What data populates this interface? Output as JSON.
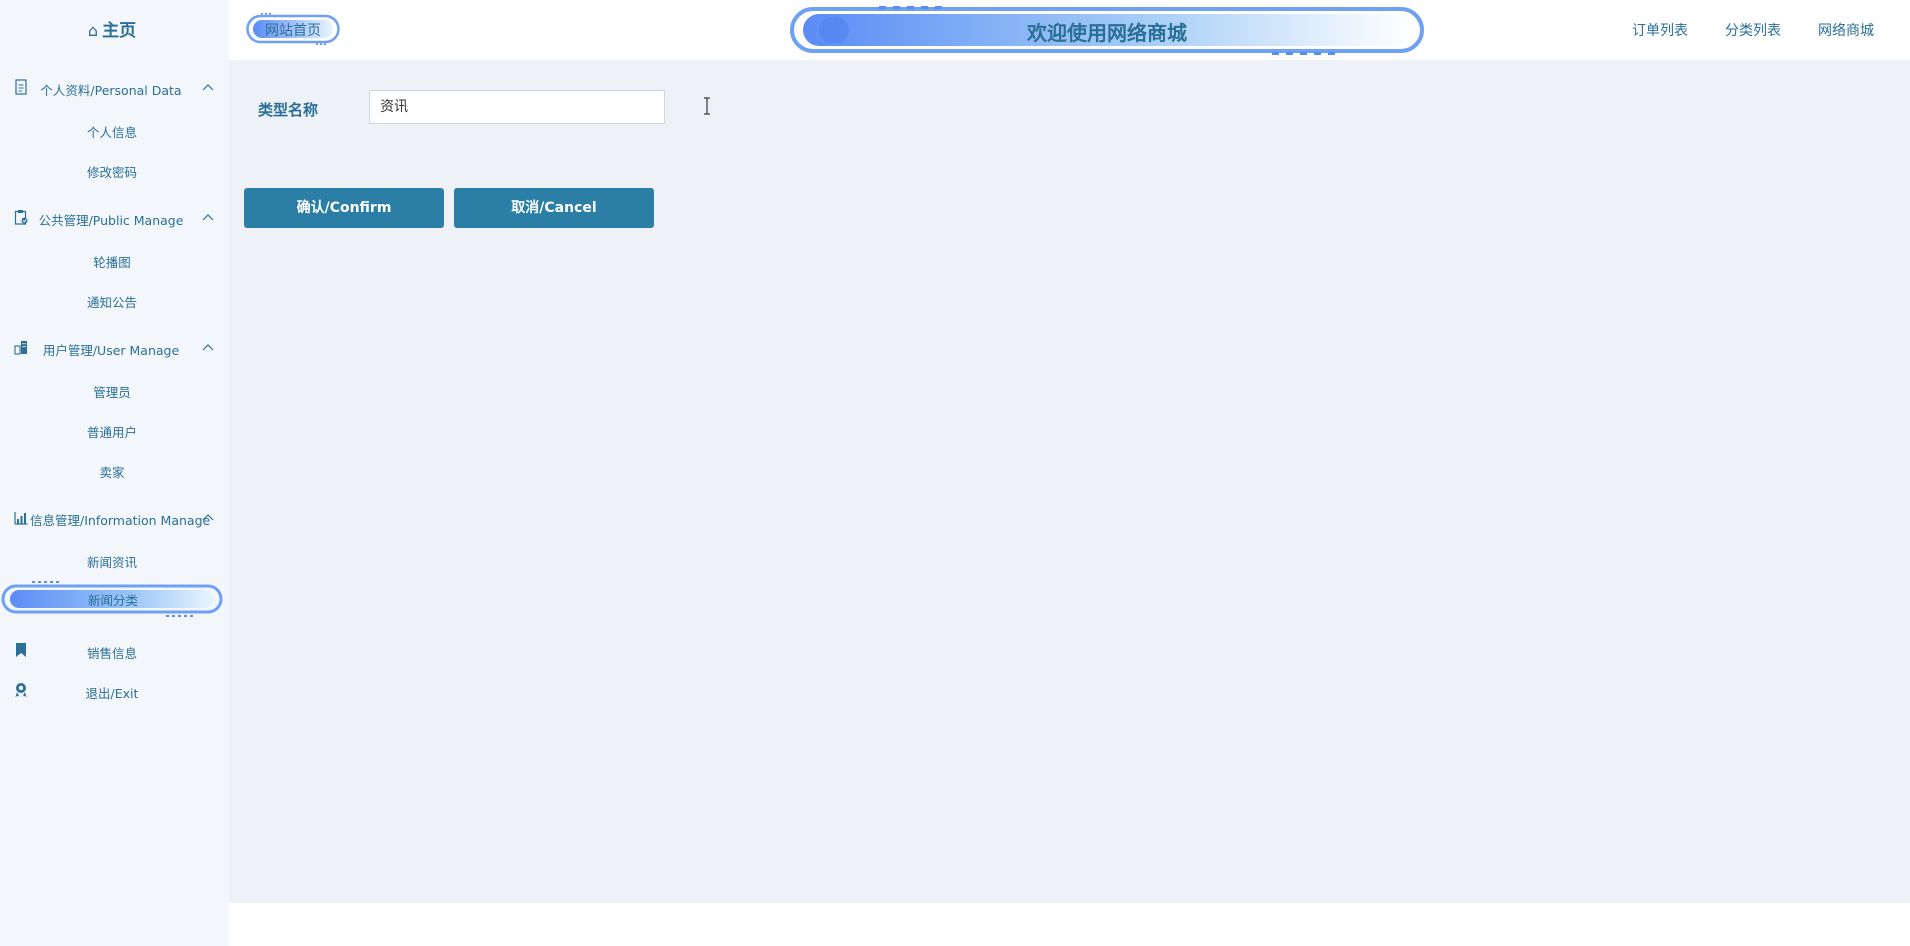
{
  "sidebar": {
    "home": {
      "icon": "home-icon",
      "label": "主页"
    },
    "groups": [
      {
        "icon": "document-icon",
        "title": "个人资料/Personal Data",
        "items": [
          "个人信息",
          "修改密码"
        ]
      },
      {
        "icon": "clipboard-icon",
        "title": "公共管理/Public Manage",
        "items": [
          "轮播图",
          "通知公告"
        ]
      },
      {
        "icon": "building-icon",
        "title": "用户管理/User Manage",
        "items": [
          "管理员",
          "普通用户",
          "卖家"
        ]
      },
      {
        "icon": "bar-chart-icon",
        "title": "信息管理/Information Manage",
        "items": [
          "新闻资讯",
          "新闻分类"
        ]
      }
    ],
    "active_item": "新闻分类",
    "singles": [
      {
        "icon": "bookmark-icon",
        "label": "销售信息"
      },
      {
        "icon": "user-badge-icon",
        "label": "退出/Exit"
      }
    ]
  },
  "header": {
    "badge_label": "网站首页",
    "title": "欢迎使用网络商城",
    "nav": [
      "订单列表",
      "分类列表",
      "网络商城"
    ]
  },
  "form": {
    "field_label": "类型名称",
    "field_value": "资讯",
    "confirm_label": "确认/Confirm",
    "cancel_label": "取消/Cancel"
  },
  "colors": {
    "accent": "#2b6f97",
    "button": "#2b7ea6",
    "pill_gradient_start": "#5b8cf5",
    "pill_gradient_end": "#e8f6ff",
    "sidebar_bg": "#f3f7fb",
    "content_bg": "#eef2f6"
  }
}
